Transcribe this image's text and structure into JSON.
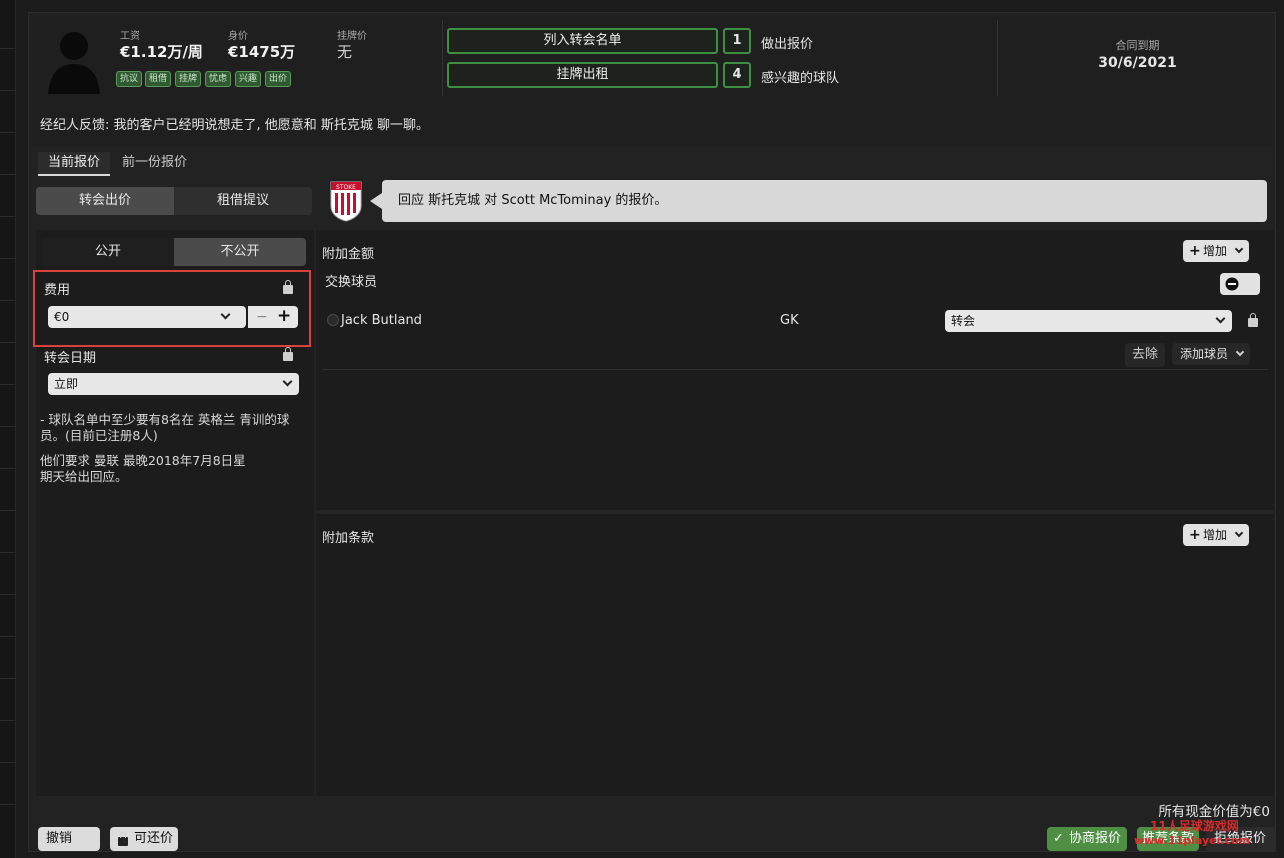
{
  "header": {
    "wage_label": "工资",
    "wage_value": "€1.12万/周",
    "value_label": "身价",
    "value_value": "€1475万",
    "asking_label": "挂牌价",
    "asking_value": "无",
    "tags": [
      "抗议",
      "租借",
      "挂牌",
      "忧虑",
      "兴趣",
      "出价"
    ],
    "transfer_list_button": "列入转会名单",
    "loan_list_button": "挂牌出租",
    "offers_count": "1",
    "offers_label": "做出报价",
    "interested_count": "4",
    "interested_label": "感兴趣的球队",
    "contract_label": "合同到期",
    "contract_value": "30/6/2021",
    "agent_feedback": "经纪人反馈: 我的客户已经明说想走了, 他愿意和 斯托克城 聊一聊。"
  },
  "tabs": {
    "current": "当前报价",
    "previous": "前一份报价"
  },
  "offer_type": {
    "transfer": "转会出价",
    "loan": "租借提议"
  },
  "visibility": {
    "public": "公开",
    "private": "不公开"
  },
  "fee": {
    "label": "费用",
    "value": "€0",
    "minus": "−",
    "plus": "+"
  },
  "transfer_date": {
    "label": "转会日期",
    "value": "立即"
  },
  "notes": {
    "homegrown": "- 球队名单中至少要有8名在 英格兰 青训的球员。(目前已注册8人)",
    "deadline": "他们要求 曼联 最晚2018年7月8日星期天给出回应。"
  },
  "message": {
    "text": "回应 斯托克城 对 Scott McTominay 的报价。",
    "club_badge_text": "STOKE"
  },
  "additional_fee": {
    "label": "附加金额",
    "add_button": "增加"
  },
  "exchange_players": {
    "label": "交换球员",
    "player_name": "Jack Butland",
    "player_position": "GK",
    "deal_type": "转会",
    "remove_button": "去除",
    "add_player_button": "添加球员"
  },
  "clauses": {
    "label": "附加条款",
    "add_button": "增加"
  },
  "footer": {
    "undo": "撤销",
    "negotiable": "可还价",
    "total_cash": "所有现金价值为€0",
    "negotiate": "协商报价",
    "suggest": "推荐条款",
    "reject": "拒绝报价",
    "watermark_line1": "11人足球游戏网",
    "watermark_line2": "www.11player.com"
  },
  "colors": {
    "accent_green": "#3f8f42",
    "highlight_red": "#d9413f",
    "panel_bg": "#1b1c1b"
  }
}
